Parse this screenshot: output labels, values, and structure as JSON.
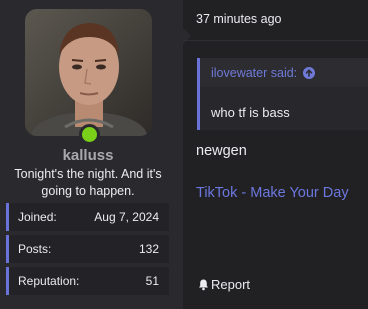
{
  "user": {
    "username": "kalluss",
    "title": "Tonight's the night. And it's going to happen.",
    "online_status_color": "#7ad019",
    "stats": [
      {
        "label": "Joined:",
        "value": "Aug 7, 2024"
      },
      {
        "label": "Posts:",
        "value": "132"
      },
      {
        "label": "Reputation:",
        "value": "51"
      }
    ]
  },
  "post": {
    "timestamp": "37 minutes ago",
    "quote": {
      "author_label": "ilovewater said:",
      "up_icon": "arrow-up-circle-icon",
      "body": "who tf is bass"
    },
    "text": "newgen",
    "link_text": "TikTok - Make Your Day",
    "report_icon": "bell-icon",
    "report_label": "Report"
  },
  "colors": {
    "accent": "#6a73d9",
    "link": "#6b77de",
    "background": "#212124",
    "panel": "#2a2a2e"
  }
}
